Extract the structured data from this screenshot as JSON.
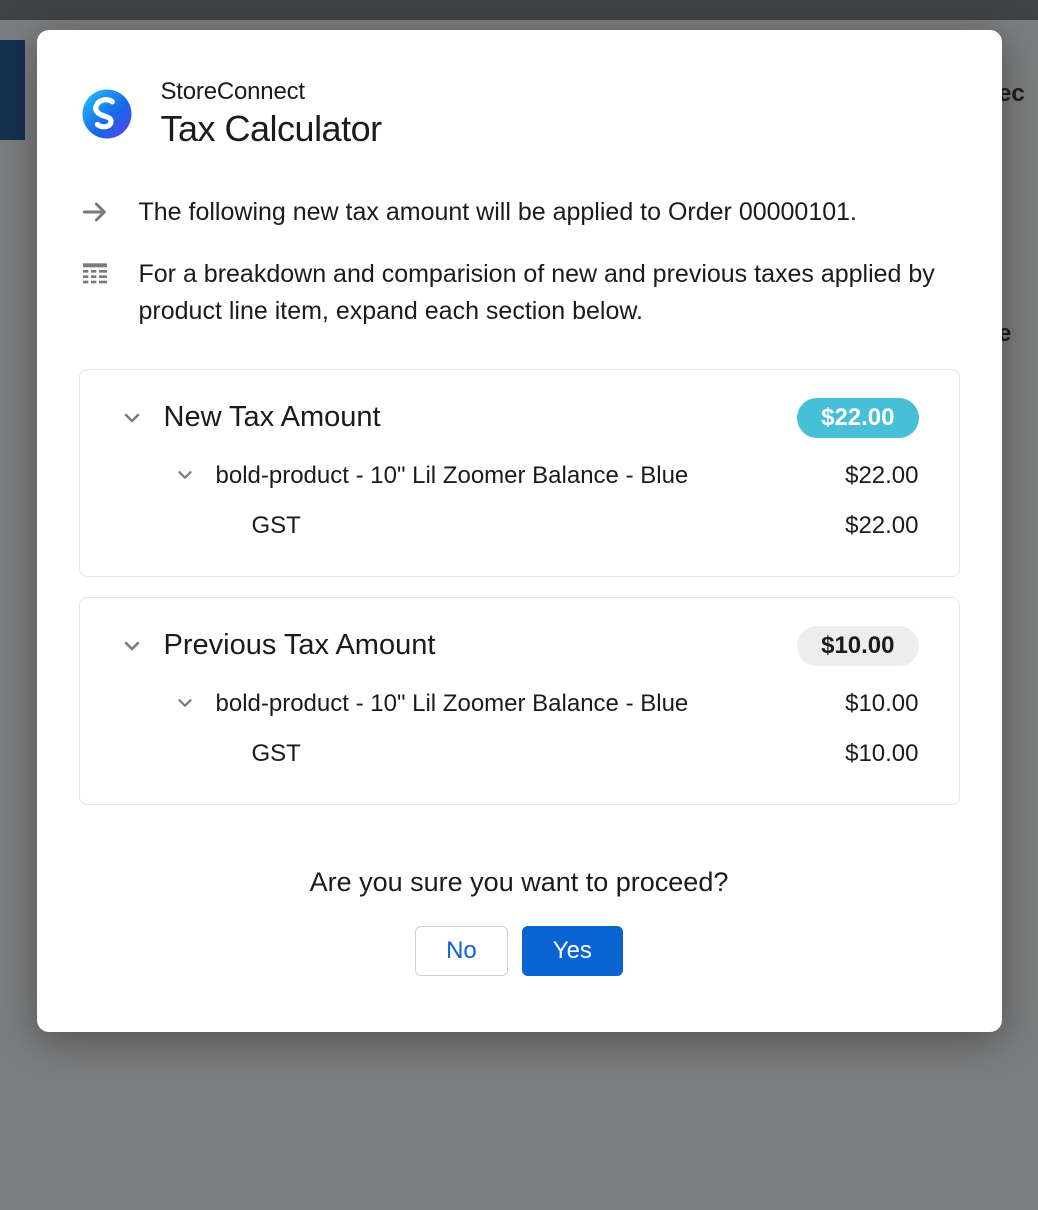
{
  "header": {
    "brand": "StoreConnect",
    "title": "Tax Calculator"
  },
  "info": {
    "line1": "The following new tax amount will be applied to Order 00000101.",
    "line2": "For a breakdown and comparision of new and previous taxes applied by product line item, expand each section below."
  },
  "new_tax": {
    "title": "New Tax Amount",
    "total": "$22.00",
    "item_name": "bold-product - 10\" Lil Zoomer Balance - Blue",
    "item_amount": "$22.00",
    "sub_name": "GST",
    "sub_amount": "$22.00"
  },
  "prev_tax": {
    "title": "Previous Tax Amount",
    "total": "$10.00",
    "item_name": "bold-product - 10\" Lil Zoomer Balance - Blue",
    "item_amount": "$10.00",
    "sub_name": "GST",
    "sub_amount": "$10.00"
  },
  "confirm": {
    "text": "Are you sure you want to proceed?",
    "no": "No",
    "yes": "Yes"
  }
}
